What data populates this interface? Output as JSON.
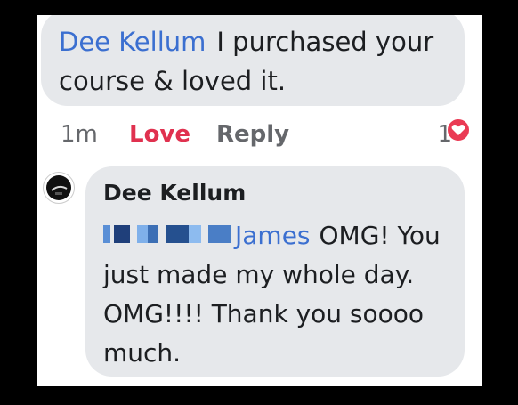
{
  "comment": {
    "author": "Dee Kellum",
    "text": "I purchased your course & loved it.",
    "time": "1m",
    "love_label": "Love",
    "reply_label": "Reply",
    "reaction_count": "1",
    "reaction_icon": "heart-icon"
  },
  "reply": {
    "author": "Dee Kellum",
    "mention": "James",
    "text": "OMG! You just made my whole day. OMG!!!! Thank you soooo much."
  },
  "colors": {
    "link": "#3b6fd0",
    "love": "#e0314f",
    "bubble": "#e6e8eb"
  }
}
